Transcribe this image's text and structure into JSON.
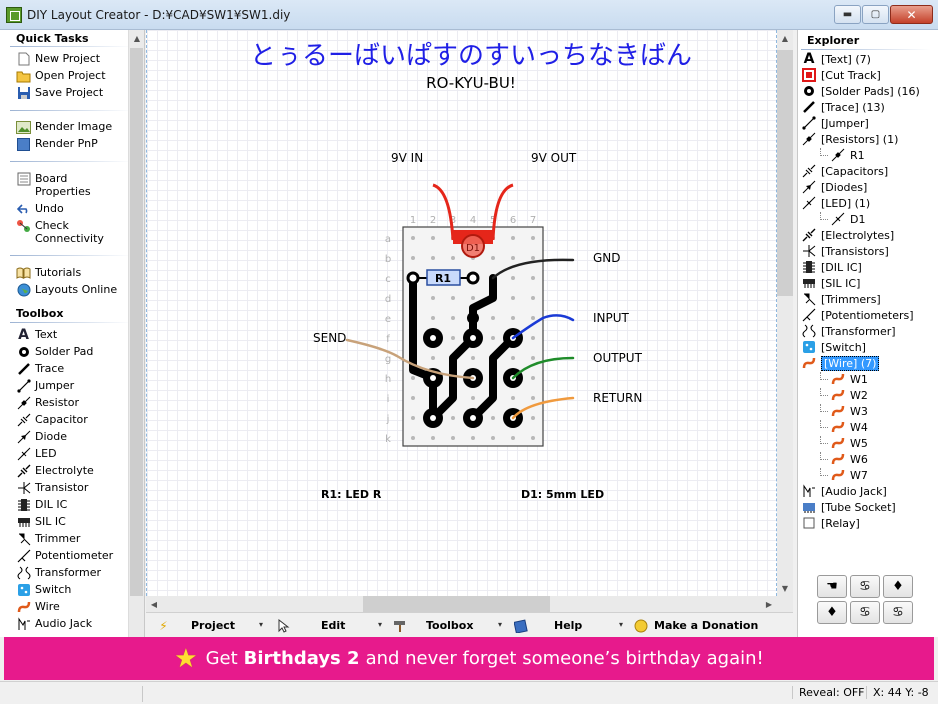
{
  "window": {
    "title": "DIY Layout Creator - D:¥CAD¥SW1¥SW1.diy",
    "min_glyph": "▬",
    "max_glyph": "▢",
    "close_glyph": "✕"
  },
  "quick_tasks": {
    "title": "Quick Tasks",
    "items": [
      {
        "label": "New Project",
        "icon": "new-project-icon"
      },
      {
        "label": "Open Project",
        "icon": "folder-icon"
      },
      {
        "label": "Save Project",
        "icon": "save-icon"
      },
      {
        "label": "Render Image",
        "icon": "image-icon"
      },
      {
        "label": "Render PnP",
        "icon": "pnp-icon"
      },
      {
        "label": "Board Properties",
        "icon": "board-icon"
      },
      {
        "label": "Undo",
        "icon": "undo-icon"
      },
      {
        "label": "Check Connectivity",
        "icon": "connectivity-icon"
      },
      {
        "label": "Tutorials",
        "icon": "book-icon"
      },
      {
        "label": "Layouts Online",
        "icon": "globe-icon"
      }
    ]
  },
  "toolbox": {
    "title": "Toolbox",
    "items": [
      "Text",
      "Solder Pad",
      "Trace",
      "Jumper",
      "Resistor",
      "Capacitor",
      "Diode",
      "LED",
      "Electrolyte",
      "Transistor",
      "DIL IC",
      "SIL IC",
      "Trimmer",
      "Potentiometer",
      "Transformer",
      "Switch",
      "Wire",
      "Audio Jack"
    ]
  },
  "canvas": {
    "title": "とぅるーばいぱすのすいっちなきばん",
    "subtitle": "RO-KYU-BU!",
    "col_numbers": [
      "1",
      "2",
      "3",
      "4",
      "5",
      "6",
      "7"
    ],
    "row_letters": [
      "a",
      "b",
      "c",
      "d",
      "e",
      "f",
      "g",
      "h",
      "i",
      "j",
      "k"
    ],
    "labels": {
      "nine_v_in": "9V IN",
      "nine_v_out": "9V OUT",
      "gnd": "GND",
      "input": "INPUT",
      "output": "OUTPUT",
      "return": "RETURN",
      "send": "SEND",
      "r1": "R1",
      "d1": "D1",
      "note_r1": "R1: LED R",
      "note_d1": "D1: 5mm LED"
    }
  },
  "bottom_toolbar": {
    "project": "Project",
    "edit": "Edit",
    "toolbox": "Toolbox",
    "help": "Help",
    "donate": "Make a Donation",
    "arrow": "▾"
  },
  "explorer": {
    "title": "Explorer",
    "items": [
      {
        "label": "[Text] (7)",
        "icon": "text-icon",
        "level": 0
      },
      {
        "label": "[Cut Track]",
        "icon": "cut-track-icon",
        "level": 0
      },
      {
        "label": "[Solder Pads] (16)",
        "icon": "solder-pad-icon",
        "level": 0
      },
      {
        "label": "[Trace] (13)",
        "icon": "trace-icon",
        "level": 0
      },
      {
        "label": "[Jumper]",
        "icon": "jumper-icon",
        "level": 0
      },
      {
        "label": "[Resistors] (1)",
        "icon": "resistor-icon",
        "level": 0
      },
      {
        "label": "R1",
        "icon": "resistor-icon",
        "level": 1
      },
      {
        "label": "[Capacitors]",
        "icon": "capacitor-icon",
        "level": 0
      },
      {
        "label": "[Diodes]",
        "icon": "diode-icon",
        "level": 0
      },
      {
        "label": "[LED] (1)",
        "icon": "led-icon",
        "level": 0
      },
      {
        "label": "D1",
        "icon": "led-icon",
        "level": 1
      },
      {
        "label": "[Electrolytes]",
        "icon": "electrolyte-icon",
        "level": 0
      },
      {
        "label": "[Transistors]",
        "icon": "transistor-icon",
        "level": 0
      },
      {
        "label": "[DIL IC]",
        "icon": "dil-ic-icon",
        "level": 0
      },
      {
        "label": "[SIL IC]",
        "icon": "sil-ic-icon",
        "level": 0
      },
      {
        "label": "[Trimmers]",
        "icon": "trimmer-icon",
        "level": 0
      },
      {
        "label": "[Potentiometers]",
        "icon": "potentiometer-icon",
        "level": 0
      },
      {
        "label": "[Transformer]",
        "icon": "transformer-icon",
        "level": 0
      },
      {
        "label": "[Switch]",
        "icon": "switch-icon",
        "level": 0
      },
      {
        "label": "[Wire] (7)",
        "icon": "wire-icon",
        "level": 0,
        "selected": true
      },
      {
        "label": "W1",
        "icon": "wire-icon",
        "level": 1
      },
      {
        "label": "W2",
        "icon": "wire-icon",
        "level": 1
      },
      {
        "label": "W3",
        "icon": "wire-icon",
        "level": 1
      },
      {
        "label": "W4",
        "icon": "wire-icon",
        "level": 1
      },
      {
        "label": "W5",
        "icon": "wire-icon",
        "level": 1
      },
      {
        "label": "W6",
        "icon": "wire-icon",
        "level": 1
      },
      {
        "label": "W7",
        "icon": "wire-icon",
        "level": 1
      },
      {
        "label": "[Audio Jack]",
        "icon": "audio-jack-icon",
        "level": 0
      },
      {
        "label": "[Tube Socket]",
        "icon": "tube-socket-icon",
        "level": 0
      },
      {
        "label": "[Relay]",
        "icon": "relay-icon",
        "level": 0
      }
    ],
    "rotate_buttons": [
      "☚",
      "♋",
      "♦",
      "♦",
      "♋",
      "♋"
    ]
  },
  "banner": {
    "prefix": "Get",
    "product": "Birthdays 2",
    "suffix": "and never forget someone’s birthday again!"
  },
  "status": {
    "reveal": "Reveal: OFF",
    "coords": "X: 44 Y: -8"
  },
  "colors": {
    "banner": "#e71a8c",
    "title_blue": "#1f1fe6",
    "led_red": "#e5261a",
    "selection": "#3399ff"
  }
}
